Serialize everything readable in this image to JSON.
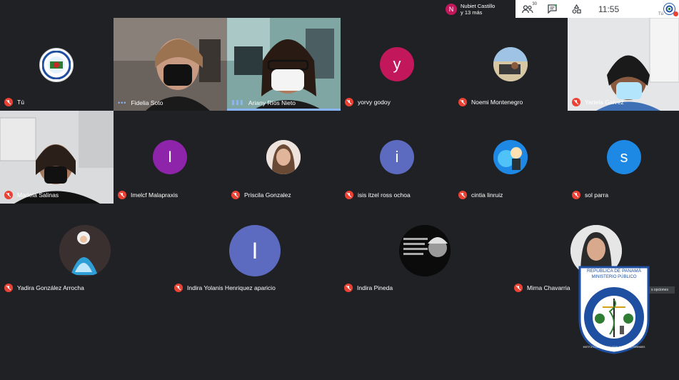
{
  "notification": {
    "initial": "N",
    "name": "Nubiet Castillo",
    "more": "y 13 más"
  },
  "toolbar": {
    "participants_count": "30",
    "clock": "11:55",
    "self_label": "Tú"
  },
  "tiles": [
    {
      "name": "Tú",
      "kind": "logo"
    },
    {
      "name": "Fidelia Soto",
      "kind": "video"
    },
    {
      "name": "Ariany Ríos Nieto",
      "kind": "video"
    },
    {
      "name": "yorvy godoy",
      "kind": "letter",
      "letter": "y",
      "color": "#c2185b"
    },
    {
      "name": "Noemi Montenegro",
      "kind": "photo"
    },
    {
      "name": "Yariela Galvez",
      "kind": "video"
    },
    {
      "name": "Mariela Salinas",
      "kind": "video"
    },
    {
      "name": "Imelcf Malapraxis",
      "kind": "letter",
      "letter": "I",
      "color": "#8e24aa"
    },
    {
      "name": "Priscila Gonzalez",
      "kind": "photo"
    },
    {
      "name": "isis itzel ross ochoa",
      "kind": "letter",
      "letter": "i",
      "color": "#5c6bc0"
    },
    {
      "name": "cintia linruiz",
      "kind": "photo"
    },
    {
      "name": "sol parra",
      "kind": "letter",
      "letter": "s",
      "color": "#1e88e5"
    },
    {
      "name": "Yadira González Arrocha",
      "kind": "photo"
    },
    {
      "name": "Indira Yolanis Henriquez aparicio",
      "kind": "letter",
      "letter": "I",
      "color": "#5c6bc0"
    },
    {
      "name": "Indira Pineda",
      "kind": "photo"
    },
    {
      "name": "Mirna Chavarria",
      "kind": "photo"
    }
  ],
  "watermark": {
    "line1": "REPÚBLICA DE PANAMÁ",
    "line2": "MINISTERIO PÚBLICO",
    "ring": "INSTITUTO DE MEDICINA LEGAL Y CIENCIAS FORENSES"
  },
  "tooltip": "s opciones",
  "colors": {
    "background": "#202124",
    "tile": "#3c4043",
    "muted": "#ea4335",
    "accent": "#8ab4f8"
  }
}
